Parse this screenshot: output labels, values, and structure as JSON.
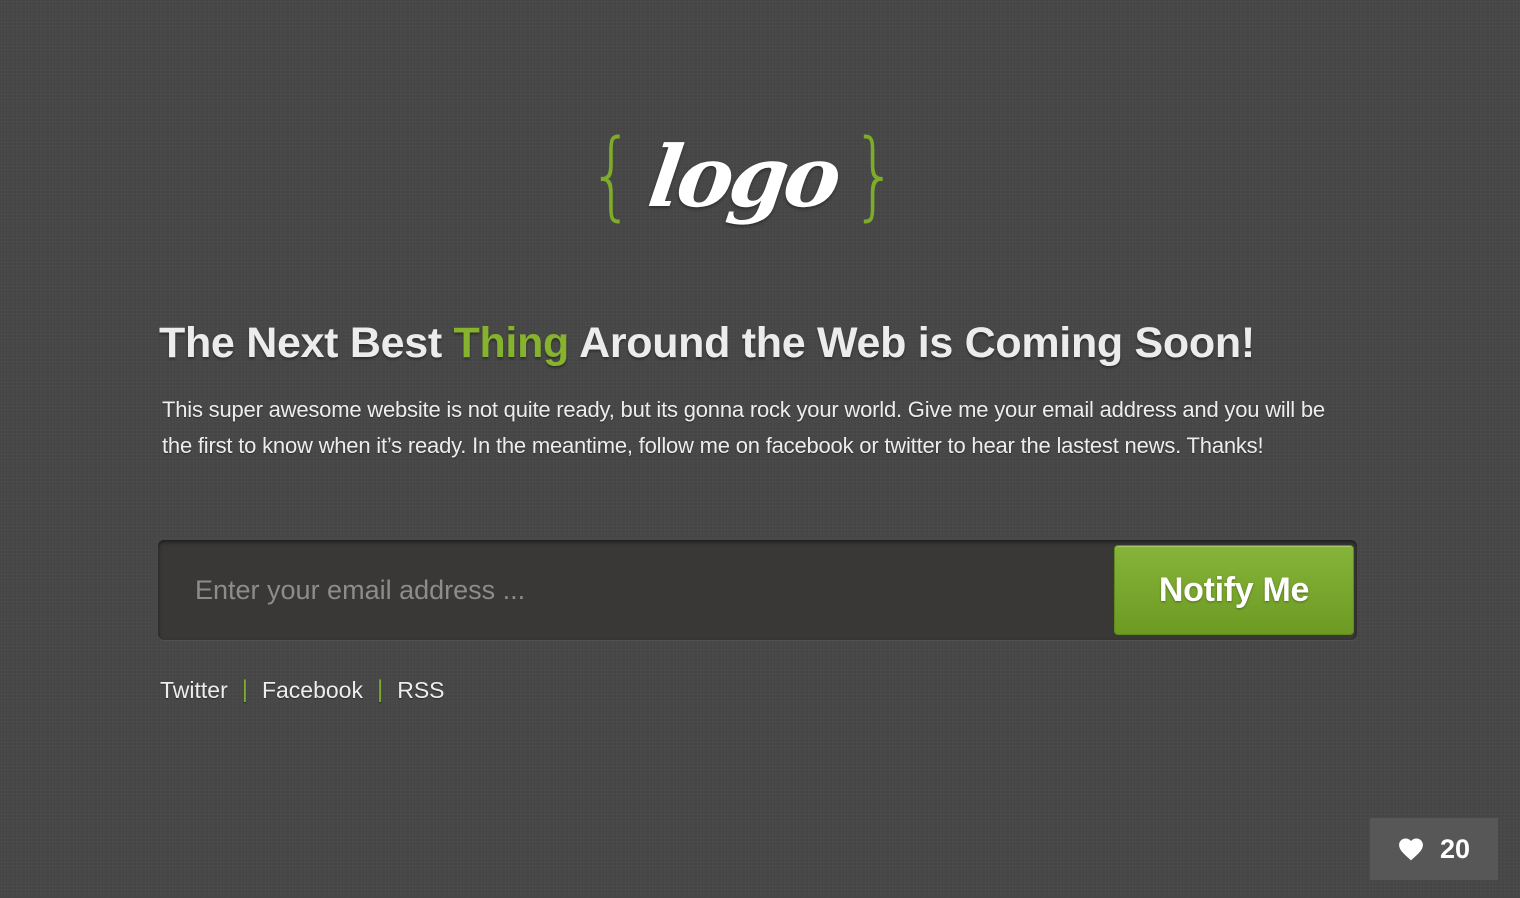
{
  "logo": {
    "left_brace": "{",
    "word": "logo",
    "right_brace": "}"
  },
  "headline": {
    "part_before": "The Next Best ",
    "accent": "Thing",
    "part_after": " Around the Web is Coming Soon!"
  },
  "description": "This super awesome website is not quite ready, but its gonna rock your world. Give me your email address and you will be the first to know when it’s ready. In the meantime, follow me on facebook or twitter to hear the lastest news. Thanks!",
  "signup": {
    "email_placeholder": "Enter your email address ...",
    "email_value": "",
    "button_label": "Notify Me"
  },
  "social": {
    "links": [
      "Twitter",
      "Facebook",
      "RSS"
    ],
    "separator": "|"
  },
  "like_badge": {
    "icon": "heart-icon",
    "count": "20"
  },
  "colors": {
    "background": "#474747",
    "accent_green": "#86b22e",
    "button_green": "#7aa72e",
    "input_background": "#3a3837"
  }
}
